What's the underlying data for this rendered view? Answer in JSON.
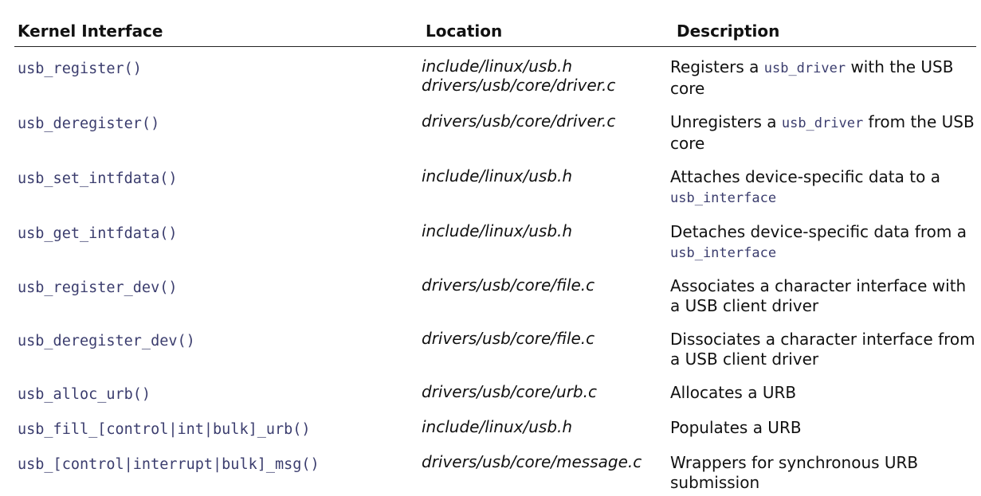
{
  "headers": {
    "interface": "Kernel Interface",
    "location": "Location",
    "description": "Description"
  },
  "rows": [
    {
      "interface": "usb_register()",
      "location": [
        "include/linux/usb.h",
        "drivers/usb/core/driver.c"
      ],
      "desc_pre": "Registers a ",
      "desc_code": "usb_driver",
      "desc_post": " with the USB core"
    },
    {
      "interface": "usb_deregister()",
      "location": [
        "drivers/usb/core/driver.c"
      ],
      "desc_pre": "Unregisters a ",
      "desc_code": "usb_driver",
      "desc_post": " from the USB core"
    },
    {
      "interface": "usb_set_intfdata()",
      "location": [
        "include/linux/usb.h"
      ],
      "desc_pre": "Attaches device-specific data to a ",
      "desc_code": "usb_interface",
      "desc_post": ""
    },
    {
      "interface": "usb_get_intfdata()",
      "location": [
        "include/linux/usb.h"
      ],
      "desc_pre": "Detaches device-specific data from a ",
      "desc_code": "usb_interface",
      "desc_post": ""
    },
    {
      "interface": "usb_register_dev()",
      "location": [
        "drivers/usb/core/file.c"
      ],
      "desc_pre": "Associates a character interface with a USB client driver",
      "desc_code": "",
      "desc_post": ""
    },
    {
      "interface": "usb_deregister_dev()",
      "location": [
        "drivers/usb/core/file.c"
      ],
      "desc_pre": "Dissociates a character interface from a USB client driver",
      "desc_code": "",
      "desc_post": ""
    },
    {
      "interface": "usb_alloc_urb()",
      "location": [
        "drivers/usb/core/urb.c"
      ],
      "desc_pre": "Allocates a URB",
      "desc_code": "",
      "desc_post": ""
    },
    {
      "interface": "usb_fill_[control|int|bulk]_urb()",
      "location": [
        "include/linux/usb.h"
      ],
      "desc_pre": "Populates a URB",
      "desc_code": "",
      "desc_post": ""
    },
    {
      "interface": "usb_[control|interrupt|bulk]_msg()",
      "location": [
        "drivers/usb/core/message.c"
      ],
      "desc_pre": "Wrappers for synchronous URB submission",
      "desc_code": "",
      "desc_post": ""
    }
  ]
}
